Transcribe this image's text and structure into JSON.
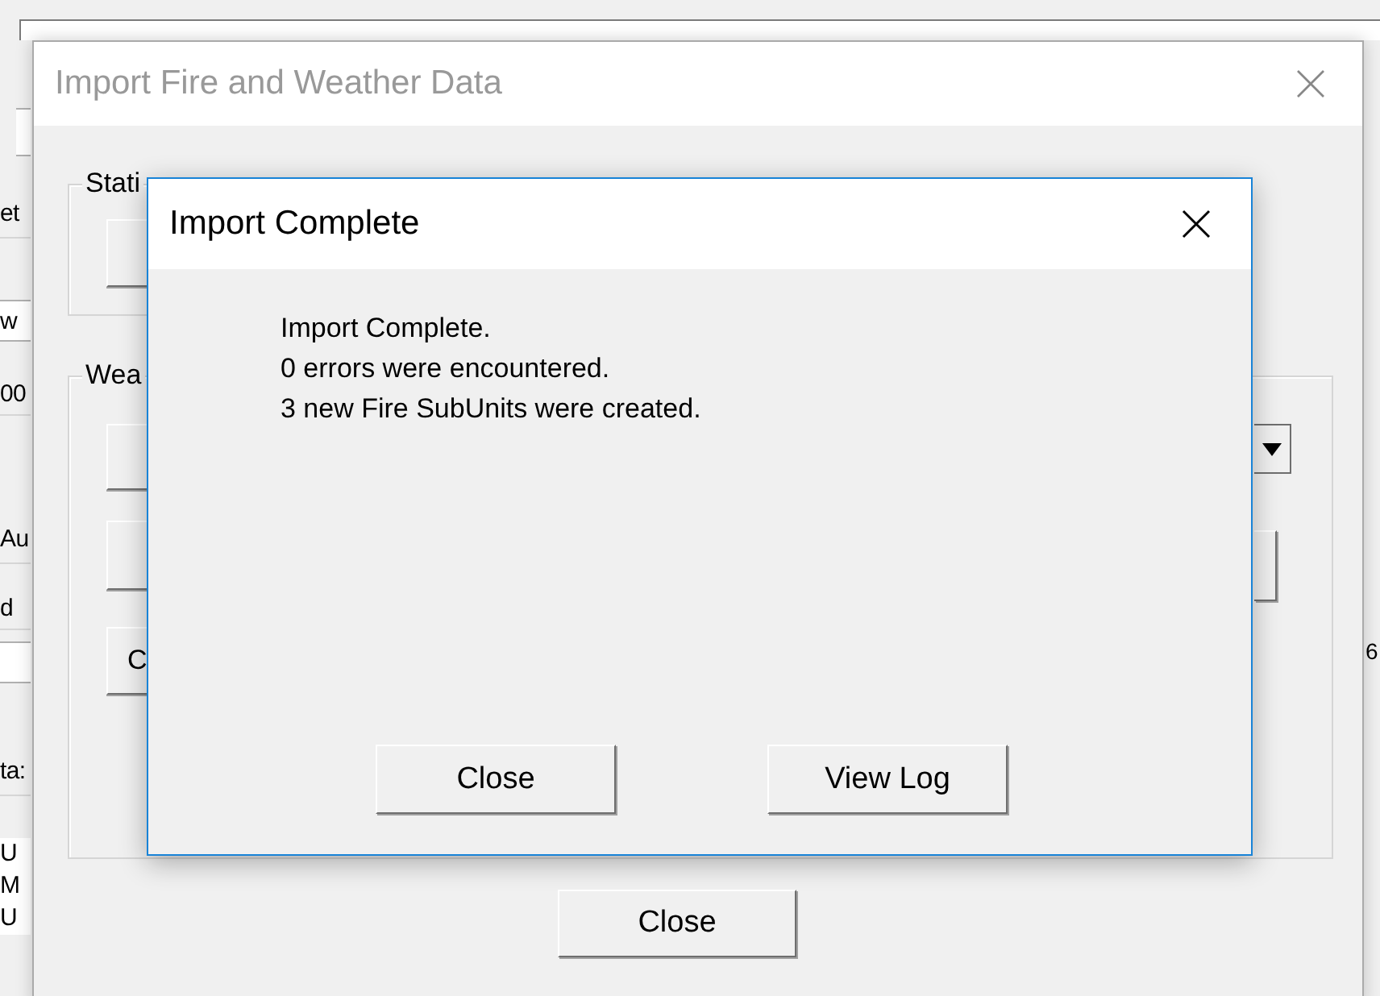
{
  "background_app": {
    "left_fragments": [
      {
        "text": "et",
        "kind": "label"
      },
      {
        "text": "w",
        "kind": "field"
      },
      {
        "text": "00",
        "kind": "label"
      },
      {
        "text": "Au",
        "kind": "label"
      },
      {
        "text": "d",
        "kind": "label"
      },
      {
        "text": "ta:",
        "kind": "label"
      },
      {
        "text": "U",
        "kind": "list"
      },
      {
        "text": "M",
        "kind": "list"
      },
      {
        "text": "U",
        "kind": "list"
      }
    ],
    "right_fragment": "6"
  },
  "import_window": {
    "title": "Import Fire and Weather Data",
    "active": false,
    "stations_group": "Stati",
    "weather_group": "Wea",
    "visible_button_text": "C",
    "close_button": "Close"
  },
  "dialog": {
    "title": "Import Complete",
    "active": true,
    "message_lines": [
      "Import Complete.",
      "0 errors were encountered.",
      "3 new Fire SubUnits were created."
    ],
    "buttons": [
      "Close",
      "View Log"
    ]
  }
}
